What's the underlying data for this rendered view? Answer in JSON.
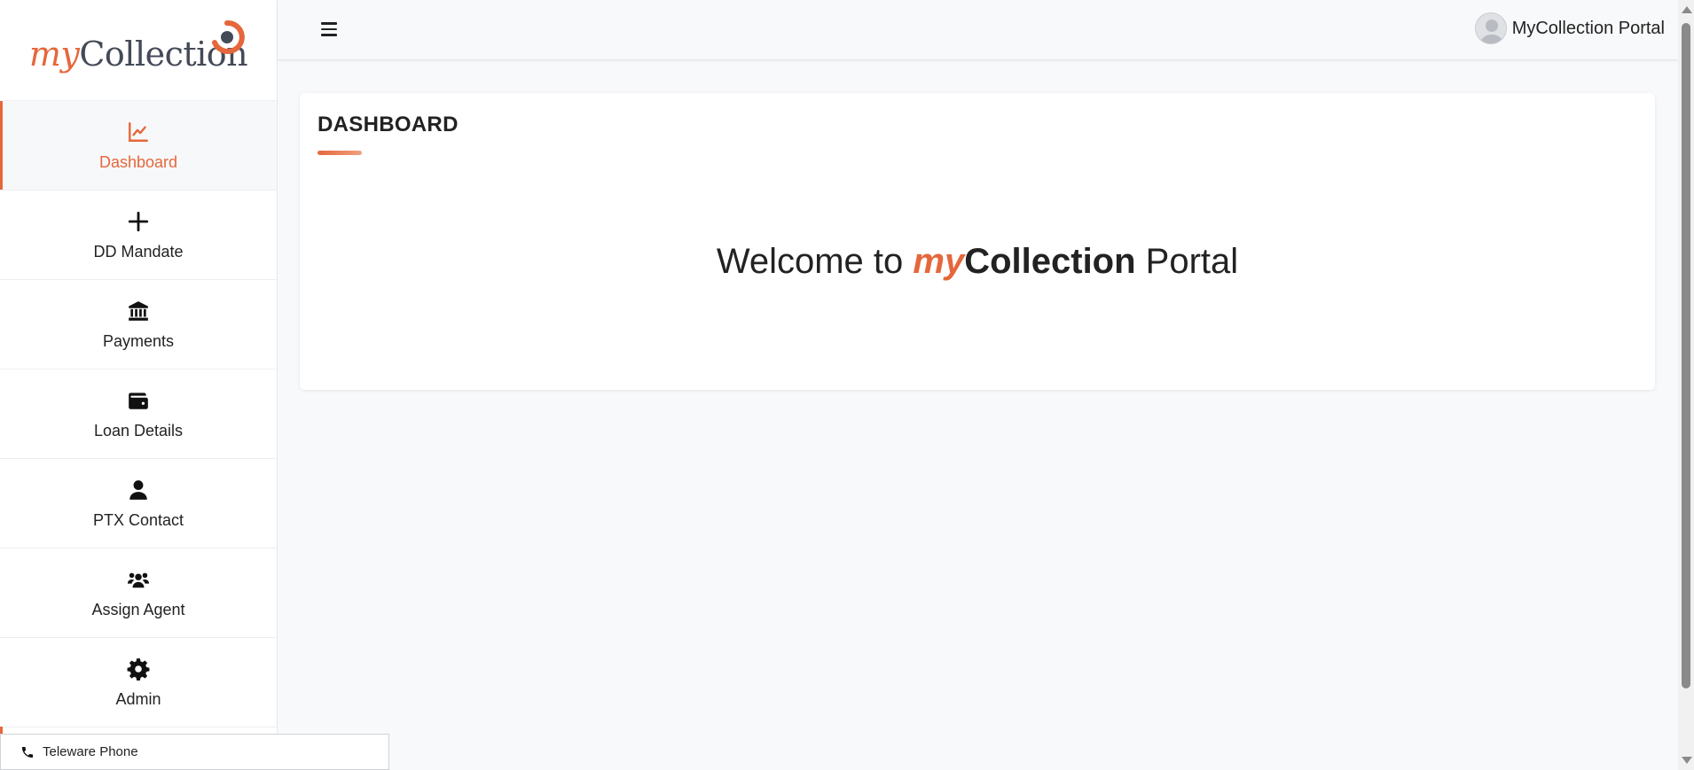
{
  "brand": {
    "logo_my": "my",
    "logo_collection": "Collection",
    "accent_color": "#e5673b",
    "dark_color": "#444a57"
  },
  "sidebar": {
    "items": [
      {
        "label": "Dashboard",
        "icon": "chart-line-icon",
        "active": true
      },
      {
        "label": "DD Mandate",
        "icon": "plus-icon",
        "active": false
      },
      {
        "label": "Payments",
        "icon": "bank-icon",
        "active": false
      },
      {
        "label": "Loan Details",
        "icon": "wallet-icon",
        "active": false
      },
      {
        "label": "PTX Contact",
        "icon": "user-icon",
        "active": false
      },
      {
        "label": "Assign Agent",
        "icon": "users-icon",
        "active": false
      },
      {
        "label": "Admin",
        "icon": "gear-icon",
        "active": false
      }
    ]
  },
  "topbar": {
    "menu_icon": "hamburger-icon",
    "user_name": "MyCollection Portal",
    "avatar_icon": "avatar-icon"
  },
  "main": {
    "title": "DASHBOARD",
    "welcome_prefix": "Welcome to ",
    "welcome_my": "my",
    "welcome_collection": "Collection",
    "welcome_suffix": " Portal"
  },
  "phone_bar": {
    "label": "Teleware Phone",
    "icon": "phone-icon"
  }
}
